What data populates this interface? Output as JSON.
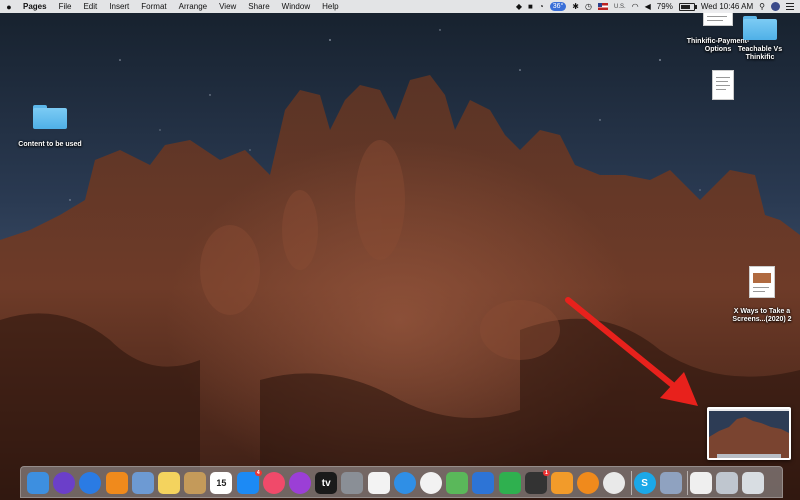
{
  "menubar": {
    "app_name": "Pages",
    "menus": [
      "File",
      "Edit",
      "Insert",
      "Format",
      "Arrange",
      "View",
      "Share",
      "Window",
      "Help"
    ],
    "status": {
      "temperature": "36°",
      "input_source": "U.S.",
      "battery_percent": "79%",
      "datetime": "Wed 10:46 AM"
    }
  },
  "desktop": {
    "items": [
      {
        "label": "Content to be used",
        "icon": "folder-icon"
      },
      {
        "label": "Thinkific-Payment-Options",
        "icon": "document-thumbnail-icon"
      },
      {
        "label": "Teachable Vs Thinkific",
        "icon": "folder-icon"
      },
      {
        "label": "",
        "icon": "document-thumbnail-icon"
      },
      {
        "label": "X Ways to Take a Screens...(2020) 2",
        "icon": "document-thumbnail-icon"
      }
    ]
  },
  "dock": {
    "apps": [
      {
        "name": "finder-icon",
        "color": "#3d8fe0"
      },
      {
        "name": "siri-icon",
        "color": "#6b3fc9"
      },
      {
        "name": "safari-icon",
        "color": "#2a7be4"
      },
      {
        "name": "books-icon",
        "color": "#f08a1c"
      },
      {
        "name": "preview-icon",
        "color": "#6d9ad3"
      },
      {
        "name": "notes-icon",
        "color": "#f4d35e"
      },
      {
        "name": "contacts-icon",
        "color": "#c49a5a"
      },
      {
        "name": "calendar-icon",
        "color": "#ffffff",
        "text": "15"
      },
      {
        "name": "app-store-icon",
        "color": "#1c8af5",
        "badge": "4"
      },
      {
        "name": "music-icon",
        "color": "#f04a6a"
      },
      {
        "name": "podcasts-icon",
        "color": "#9b3fd6"
      },
      {
        "name": "apple-tv-icon",
        "color": "#1a1a1a",
        "text": "tv"
      },
      {
        "name": "system-preferences-icon",
        "color": "#8a8f96"
      },
      {
        "name": "reminders-icon",
        "color": "#f3f3f3"
      },
      {
        "name": "messages-icon",
        "color": "#2f8fe6"
      },
      {
        "name": "photos-icon",
        "color": "#f2f2f2"
      },
      {
        "name": "maps-icon",
        "color": "#5ab85a"
      },
      {
        "name": "keynote-icon",
        "color": "#2d74d6"
      },
      {
        "name": "numbers-icon",
        "color": "#2fb04f"
      },
      {
        "name": "activity-monitor-icon",
        "color": "#333333",
        "badge": "1"
      },
      {
        "name": "pages-icon",
        "color": "#f29b2a"
      },
      {
        "name": "vlc-icon",
        "color": "#f08a1c"
      },
      {
        "name": "chrome-icon",
        "color": "#e9e9e9"
      },
      {
        "name": "skype-icon",
        "color": "#1ba8e8",
        "text": "S"
      },
      {
        "name": "image-capture-icon",
        "color": "#8fa2c0"
      },
      {
        "name": "screenshot-doc-icon",
        "color": "#efefef"
      },
      {
        "name": "downloads-icon",
        "color": "#bfc6cf"
      },
      {
        "name": "trash-icon",
        "color": "#d8dde2"
      }
    ]
  }
}
